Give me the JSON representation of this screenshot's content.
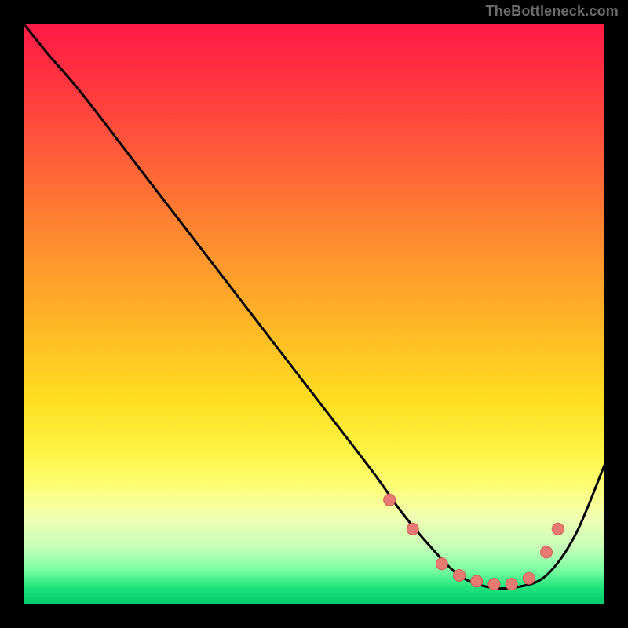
{
  "watermark": "TheBottleneck.com",
  "colors": {
    "frame": "#000000",
    "line": "#000000",
    "marker_fill": "#e77a73",
    "marker_stroke": "#d55d56",
    "gradient_top": "#ff1a47",
    "gradient_bottom": "#00c96a"
  },
  "chart_data": {
    "type": "line",
    "title": "",
    "xlabel": "",
    "ylabel": "",
    "xlim": [
      0,
      100
    ],
    "ylim": [
      0,
      100
    ],
    "x": [
      0,
      4,
      10,
      20,
      30,
      40,
      50,
      60,
      65,
      70,
      75,
      80,
      85,
      90,
      95,
      100
    ],
    "values": [
      100,
      95,
      88,
      75,
      62,
      49,
      36,
      23,
      16,
      10,
      5,
      3,
      3,
      5,
      12,
      24
    ],
    "markers": {
      "x": [
        63,
        67,
        72,
        75,
        78,
        81,
        84,
        87,
        90,
        92
      ],
      "y": [
        18,
        13,
        7,
        5,
        4,
        3.5,
        3.5,
        4.5,
        9,
        13
      ]
    }
  }
}
